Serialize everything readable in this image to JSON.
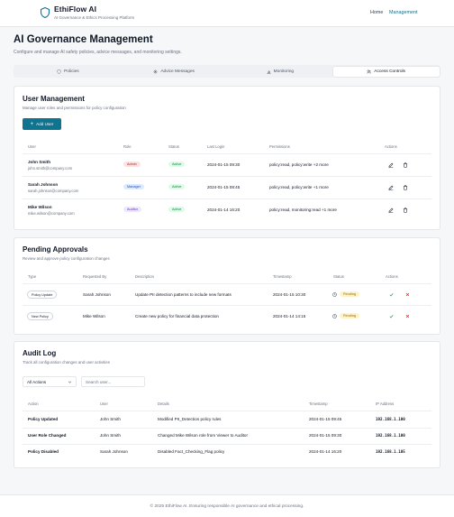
{
  "header": {
    "brand": "EthiFlow AI",
    "tagline": "AI Governance & Ethics Processing Platform",
    "nav": [
      "Home",
      "Management"
    ]
  },
  "page": {
    "title": "AI Governance Management",
    "subtitle": "Configure and manage AI safety policies, advice messages, and monitoring settings."
  },
  "tabs": [
    {
      "label": "Policies",
      "icon": "shield-icon"
    },
    {
      "label": "Advice Messages",
      "icon": "gear-icon"
    },
    {
      "label": "Monitoring",
      "icon": "bar-chart-icon"
    },
    {
      "label": "Access Controls",
      "icon": "users-icon",
      "active": true
    }
  ],
  "users": {
    "title": "User Management",
    "subtitle": "Manage user roles and permissions for policy configuration",
    "add_button": "Add User",
    "columns": [
      "User",
      "Role",
      "Status",
      "Last Login",
      "Permissions",
      "Actions"
    ],
    "rows": [
      {
        "name": "John Smith",
        "email": "john.smith@company.com",
        "role": "Admin",
        "status": "Active",
        "last_login": "2024-01-15 09:30",
        "permissions": "policy:read, policy:write +2 more"
      },
      {
        "name": "Sarah Johnson",
        "email": "sarah.johnson@company.com",
        "role": "Manager",
        "status": "Active",
        "last_login": "2024-01-15 08:45",
        "permissions": "policy:read, policy:write +1 more"
      },
      {
        "name": "Mike Wilson",
        "email": "mike.wilson@company.com",
        "role": "Auditor",
        "status": "Active",
        "last_login": "2024-01-14 16:20",
        "permissions": "policy:read, monitoring:read +1 more"
      }
    ]
  },
  "approvals": {
    "title": "Pending Approvals",
    "subtitle": "Review and approve policy configuration changes",
    "columns": [
      "Type",
      "Requested By",
      "Description",
      "Timestamp",
      "Status",
      "Actions"
    ],
    "rows": [
      {
        "type": "Policy Update",
        "requested_by": "Sarah Johnson",
        "description": "Update PII detection patterns to include new formats",
        "timestamp": "2024-01-15 10:30",
        "status": "Pending"
      },
      {
        "type": "New Policy",
        "requested_by": "Mike Wilson",
        "description": "Create new policy for financial data protection",
        "timestamp": "2024-01-14 14:15",
        "status": "Pending"
      }
    ]
  },
  "audit": {
    "title": "Audit Log",
    "subtitle": "Track all configuration changes and user activities",
    "filter_value": "All Actions",
    "search_placeholder": "Search user...",
    "columns": [
      "Action",
      "User",
      "Details",
      "Timestamp",
      "IP Address"
    ],
    "rows": [
      {
        "action": "Policy Updated",
        "user": "John Smith",
        "details": "Modified PII_Detection policy rules",
        "timestamp": "2024-01-15 09:45",
        "ip": "192.168.1.100"
      },
      {
        "action": "User Role Changed",
        "user": "John Smith",
        "details": "Changed Mike Wilson role from Viewer to Auditor",
        "timestamp": "2024-01-15 09:30",
        "ip": "192.168.1.100"
      },
      {
        "action": "Policy Disabled",
        "user": "Sarah Johnson",
        "details": "Disabled Fact_Checking_Flag policy",
        "timestamp": "2024-01-14 16:20",
        "ip": "192.168.1.105"
      }
    ]
  },
  "footer": {
    "text": "© 2025 EthiFlow AI. Ensuring responsible AI governance and ethical processing."
  },
  "colors": {
    "accent": "#0e7490",
    "approve": "#16a34a",
    "reject": "#dc2626"
  }
}
